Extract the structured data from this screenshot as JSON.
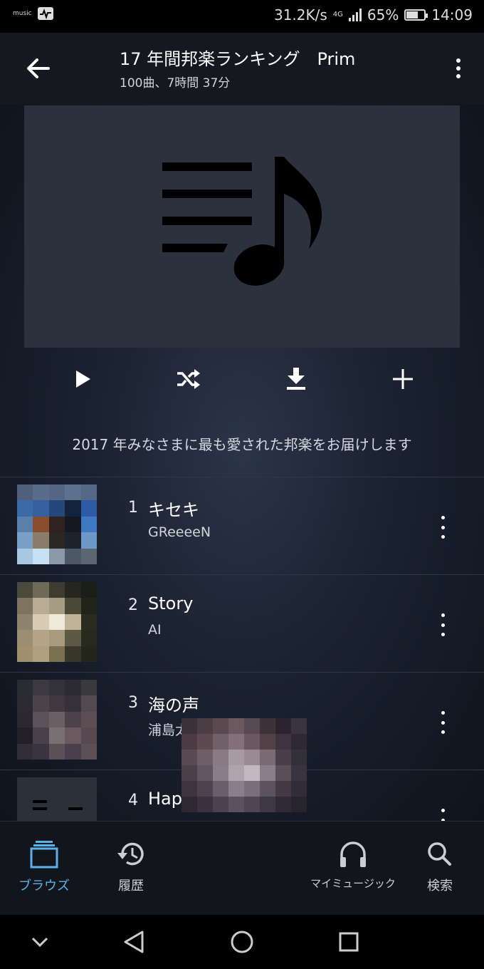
{
  "status_bar": {
    "app_label": "music",
    "net_speed": "31.2K/s",
    "network": "4G",
    "battery": "65%",
    "battery_level": 0.65,
    "time": "14:09"
  },
  "header": {
    "title": "17 年間邦楽ランキング　Prim",
    "subtitle": "100曲、7時間 37分"
  },
  "description": "2017 年みなさまに最も愛された邦楽をお届けします",
  "icons": {
    "back": "arrow-left-icon",
    "more": "more-vertical-icon",
    "cover": "playlist-music-icon",
    "play": "play-icon",
    "shuffle": "shuffle-icon",
    "download": "download-icon",
    "add": "plus-icon"
  },
  "tracks": [
    {
      "number": "1",
      "title": "キセキ",
      "artist": "GReeeeN"
    },
    {
      "number": "2",
      "title": "Story",
      "artist": "AI"
    },
    {
      "number": "3",
      "title": "海の声",
      "artist": "浦島太郎 (桐谷健太)"
    },
    {
      "number": "4",
      "title": "Happiness",
      "artist": ""
    }
  ],
  "bottom_nav": [
    {
      "label": "ブラウズ",
      "icon": "browse-icon",
      "active": true
    },
    {
      "label": "履歴",
      "icon": "history-icon",
      "active": false
    },
    {
      "label": "マイミュージック",
      "icon": "headphones-icon",
      "active": false
    },
    {
      "label": "検索",
      "icon": "search-icon",
      "active": false
    }
  ],
  "colors": {
    "accent": "#5ab3e8",
    "background": "#1a2130",
    "appbar": "#15191f"
  }
}
